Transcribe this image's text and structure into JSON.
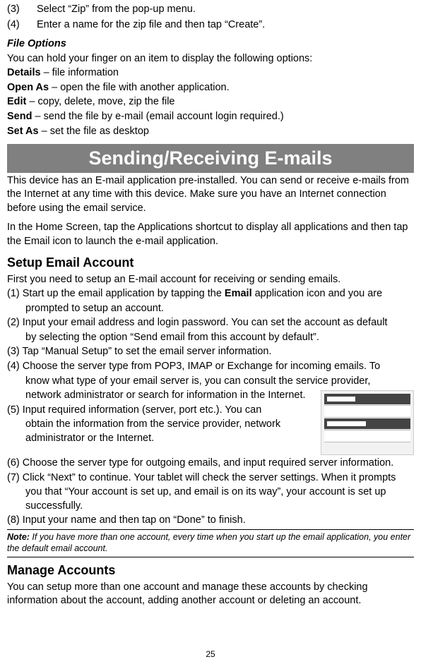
{
  "top_steps": [
    {
      "num": "(3)",
      "text": "Select “Zip” from the pop-up menu."
    },
    {
      "num": "(4)",
      "text": "Enter a name for the zip file and then tap “Create”."
    }
  ],
  "file_options": {
    "heading": "File Options",
    "intro": "You can hold your finger on an item to display the following options:",
    "items": [
      {
        "name": "Details",
        "desc": " – file information"
      },
      {
        "name": "Open As",
        "desc": " – open the file with another application."
      },
      {
        "name": "Edit",
        "desc": " – copy, delete, move, zip the file"
      },
      {
        "name": "Send",
        "desc": " – send the file by e-mail (email account login required.)"
      },
      {
        "name": "Set As",
        "desc": " – set the file as desktop"
      }
    ]
  },
  "banner": "Sending/Receiving E-mails",
  "para1": "This device has an E-mail application pre-installed. You can send or receive e-mails from the Internet at any time with this device. Make sure you have an Internet connection before using the email service.",
  "para2": "In the Home Screen, tap the Applications shortcut to display all applications and then tap the Email icon to launch the e-mail application.",
  "setup": {
    "heading": "Setup Email Account",
    "intro": "First you need to setup an E-mail account for receiving or sending emails.",
    "step1_prefix": "(1) Start up the email application by tapping the ",
    "step1_bold": "Email",
    "step1_suffix": " application icon and you are",
    "step1_line2": "prompted to setup an account.",
    "step2_a": "(2) Input your email address and login password. You can set the account as default",
    "step2_b": "by selecting the option “Send email from this account by default”.",
    "step3": "(3) Tap “Manual Setup” to set the email server information.",
    "step4_a": "(4) Choose the server type from POP3, IMAP or Exchange for incoming emails. To",
    "step4_b": "know what type of your email server is, you can consult the service provider,",
    "step4_c": "network administrator or search for information in the Internet.",
    "step5_a": "(5) Input required information (server, port etc.). You can",
    "step5_b": "obtain the information from the service provider, network administrator or the Internet.",
    "step6": "(6) Choose the server type for outgoing emails, and input required server information.",
    "step7_a": "(7) Click “Next” to continue. Your tablet will check the server settings. When it prompts",
    "step7_b": "you that “Your account is set up, and email is on its way”, your account is set up successfully.",
    "step8": "(8) Input your name and then tap on “Done” to finish."
  },
  "note": {
    "label": "Note:",
    "text": " If you have more than one account, every time when you start up the email application, you enter the default email account."
  },
  "manage": {
    "heading": "Manage Accounts",
    "text": "You can setup more than one account and manage these accounts by checking information about the account, adding another account or deleting an account."
  },
  "page_number": "25"
}
